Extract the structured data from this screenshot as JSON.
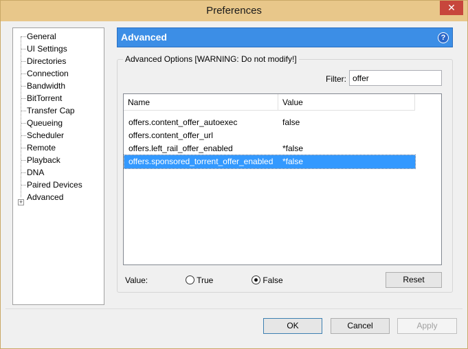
{
  "window": {
    "title": "Preferences",
    "close_label": "✕"
  },
  "tree": {
    "items": [
      {
        "label": "General"
      },
      {
        "label": "UI Settings"
      },
      {
        "label": "Directories"
      },
      {
        "label": "Connection"
      },
      {
        "label": "Bandwidth"
      },
      {
        "label": "BitTorrent"
      },
      {
        "label": "Transfer Cap"
      },
      {
        "label": "Queueing"
      },
      {
        "label": "Scheduler"
      },
      {
        "label": "Remote"
      },
      {
        "label": "Playback"
      },
      {
        "label": "DNA"
      },
      {
        "label": "Paired Devices"
      },
      {
        "label": "Advanced"
      }
    ],
    "expander_symbol": "+"
  },
  "header": {
    "title": "Advanced",
    "help_symbol": "?"
  },
  "group": {
    "label": "Advanced Options [WARNING: Do not modify!]",
    "filter_label": "Filter:",
    "filter_value": "offer"
  },
  "list": {
    "columns": [
      "Name",
      "Value"
    ],
    "rows": [
      {
        "name": "offers.content_offer_autoexec",
        "value": "false"
      },
      {
        "name": "offers.content_offer_url",
        "value": ""
      },
      {
        "name": "offers.left_rail_offer_enabled",
        "value": "*false"
      },
      {
        "name": "offers.sponsored_torrent_offer_enabled",
        "value": "*false"
      }
    ],
    "selected_index": 3
  },
  "value_editor": {
    "label": "Value:",
    "true_label": "True",
    "false_label": "False",
    "selected": "False",
    "reset_label": "Reset"
  },
  "footer": {
    "ok_label": "OK",
    "cancel_label": "Cancel",
    "apply_label": "Apply"
  },
  "colors": {
    "title_bar": "#e8c78a",
    "header": "#3c8ee6",
    "selection": "#3399ff",
    "close": "#c7463c"
  }
}
